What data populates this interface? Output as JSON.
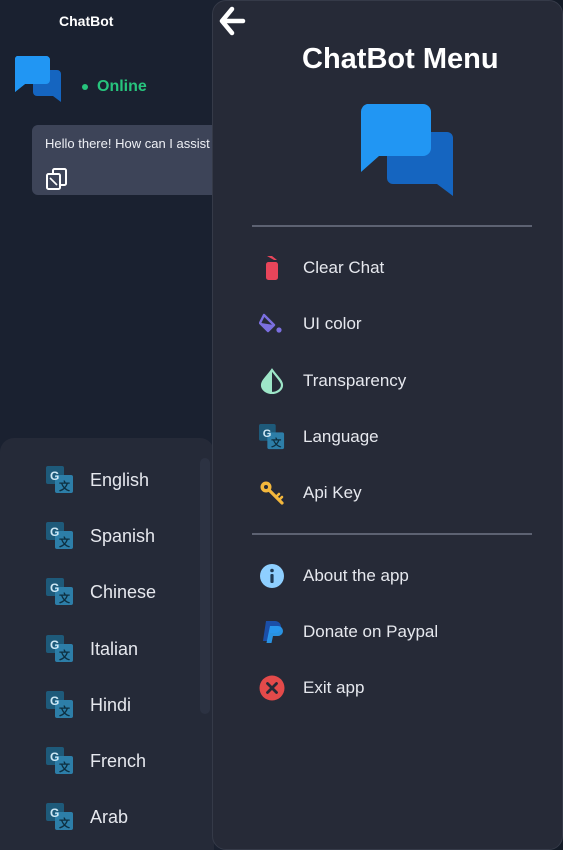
{
  "app": {
    "title": "ChatBot",
    "status": "Online"
  },
  "chat": {
    "message": "Hello there! How can I assist you today?"
  },
  "menu": {
    "title": "ChatBot Menu",
    "items": [
      {
        "label": "Clear Chat",
        "icon": "clear-chat-icon"
      },
      {
        "label": "UI color",
        "icon": "paint-bucket-icon"
      },
      {
        "label": "Transparency",
        "icon": "transparency-drop-icon"
      },
      {
        "label": "Language",
        "icon": "translate-icon"
      },
      {
        "label": "Api Key",
        "icon": "key-icon"
      },
      {
        "label": "About the app",
        "icon": "info-icon"
      },
      {
        "label": "Donate on Paypal",
        "icon": "paypal-icon"
      },
      {
        "label": "Exit app",
        "icon": "exit-icon"
      }
    ]
  },
  "languages": [
    "English",
    "Spanish",
    "Chinese",
    "Italian",
    "Hindi",
    "French",
    "Arab"
  ],
  "colors": {
    "accent": "#1e88e5",
    "online": "#27c47d",
    "clear": "#e8455a",
    "paint": "#7b6fe0",
    "transparency": "#9ee6c8",
    "key": "#f3b73c",
    "info": "#8ecfff",
    "paypal": "#2a7ad8",
    "exit": "#e34a4a"
  }
}
